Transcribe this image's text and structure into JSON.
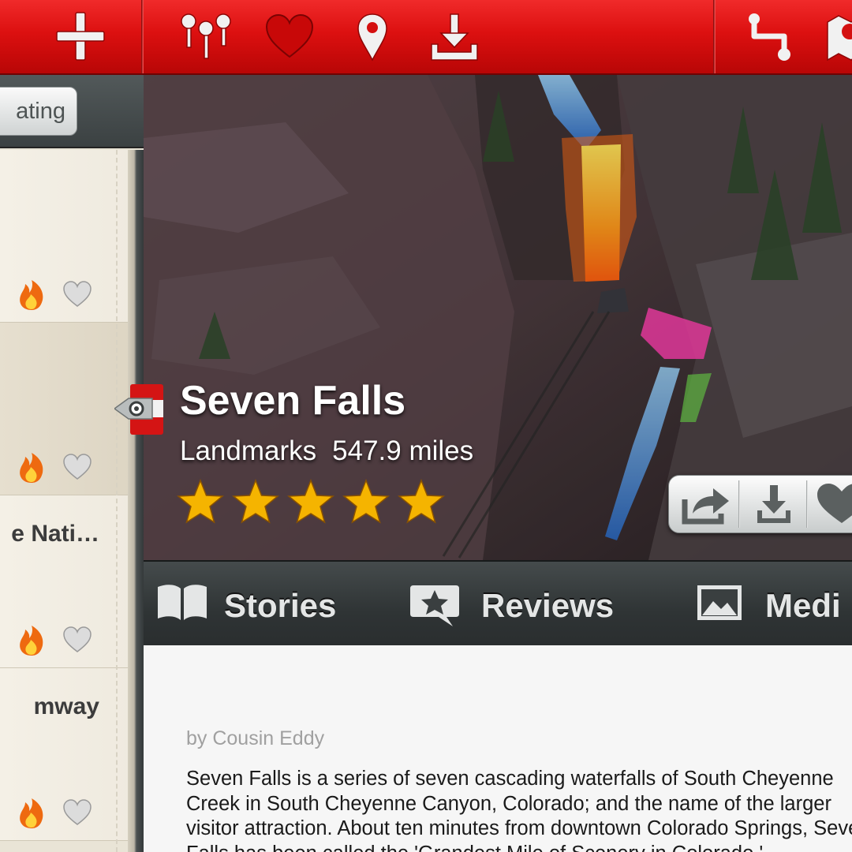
{
  "sidebar": {
    "sort_label": "ating",
    "items": [
      {
        "title": "",
        "selected": false
      },
      {
        "title": "",
        "selected": true
      },
      {
        "title": "e Nati…",
        "selected": false
      },
      {
        "title": "mway",
        "selected": false
      }
    ],
    "item_icons": [
      "fire-icon",
      "heart-icon"
    ]
  },
  "toolbar": {
    "icons": [
      "add-icon",
      "filter-pins-icon",
      "heart-icon",
      "location-pin-icon",
      "download-icon",
      "route-icon",
      "map-icon"
    ]
  },
  "place": {
    "name": "Seven Falls",
    "category": "Landmarks",
    "distance": "547.9 miles",
    "rating": 5,
    "rating_max": 5
  },
  "actions": [
    "share-icon",
    "download-icon",
    "heart-icon"
  ],
  "tabs": [
    {
      "label": "Stories",
      "icon": "book-icon",
      "active": true
    },
    {
      "label": "Reviews",
      "icon": "review-star-icon",
      "active": false
    },
    {
      "label": "Medi",
      "icon": "photo-icon",
      "active": false
    }
  ],
  "story": {
    "byline": "by Cousin Eddy",
    "body": "Seven Falls is a series of seven cascading waterfalls of South Cheyenne Creek in South Cheyenne Canyon, Colorado; and the name of the larger visitor attraction. About ten minutes from downtown Colorado Springs, Seven Falls has been called the 'Grandest Mile of Scenery in Colorado.'"
  },
  "colors": {
    "toolbar_red": "#dc1010",
    "star_gold": "#f5b400",
    "fire_orange": "#f07a12",
    "panel_cream": "#f4f0e6"
  }
}
